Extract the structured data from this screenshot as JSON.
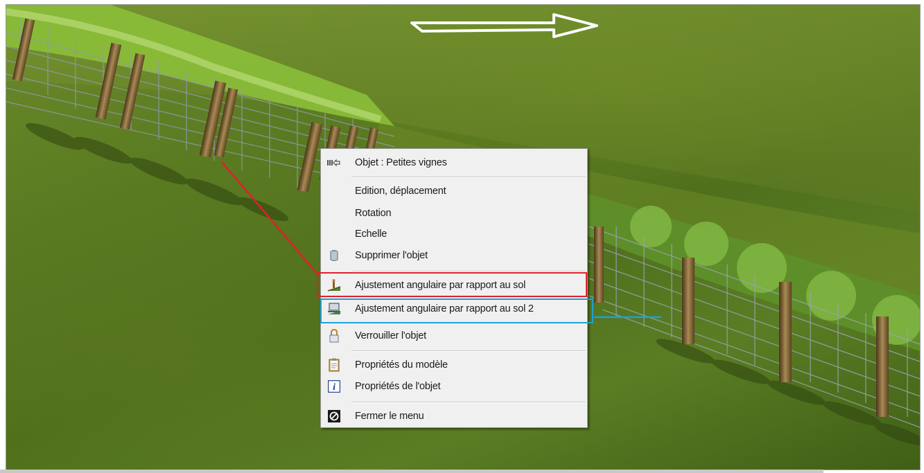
{
  "menu": {
    "header": {
      "icon": "object-arrow-icon",
      "label": "Objet : Petites vignes"
    },
    "items": [
      {
        "id": "edit-move",
        "label": "Edition, déplacement",
        "icon": ""
      },
      {
        "id": "rotation",
        "label": "Rotation",
        "icon": ""
      },
      {
        "id": "scale",
        "label": "Echelle",
        "icon": ""
      },
      {
        "id": "delete",
        "label": "Supprimer l'objet",
        "icon": "trash-can-icon"
      },
      {
        "id": "ground-adjust",
        "label": "Ajustement angulaire par rapport au sol",
        "icon": "slope-adjust-icon"
      },
      {
        "id": "ground-adjust-2",
        "label": "Ajustement angulaire par rapport au sol 2",
        "icon": "slope-adjust-2-icon"
      },
      {
        "id": "lock",
        "label": "Verrouiller l'objet",
        "icon": "padlock-icon"
      },
      {
        "id": "model-props",
        "label": "Propriétés du modèle",
        "icon": "clipboard-icon"
      },
      {
        "id": "object-props",
        "label": "Propriétés de l'objet",
        "icon": "info-icon"
      },
      {
        "id": "close-menu",
        "label": "Fermer le menu",
        "icon": "no-entry-icon"
      }
    ]
  },
  "annotations": {
    "red_color": "#e0202a",
    "blue_color": "#1ea0d8"
  }
}
